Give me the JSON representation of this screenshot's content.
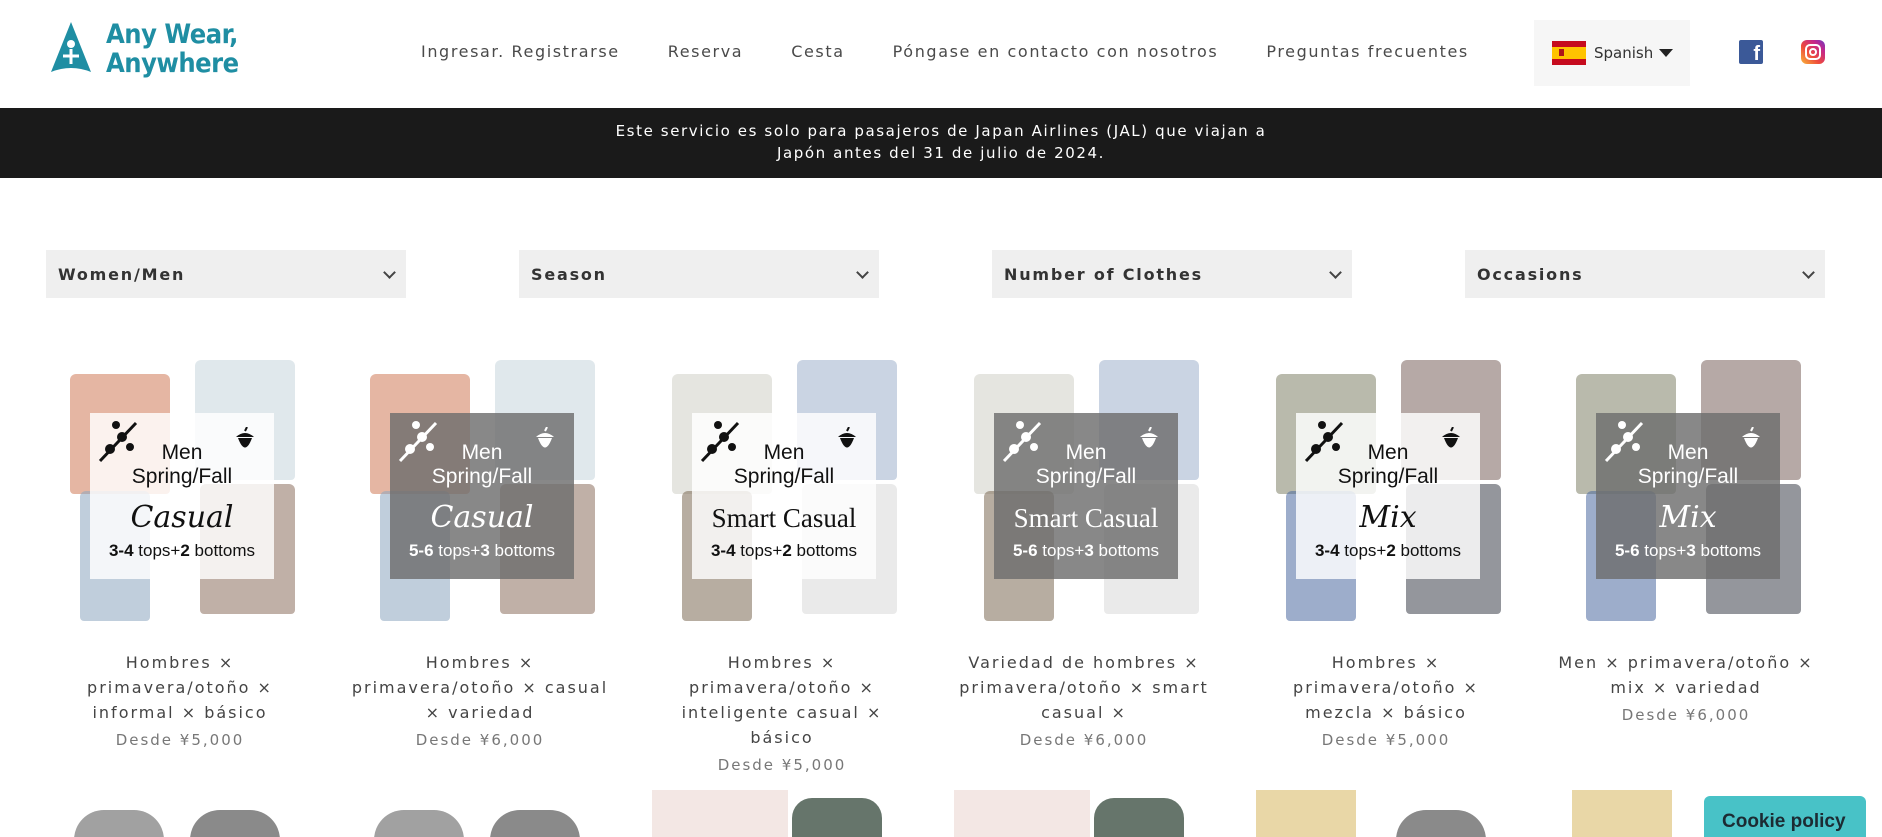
{
  "brand": {
    "name_line1": "Any Wear,",
    "name_line2": "Anywhere",
    "color": "#1f8ea3"
  },
  "nav": {
    "login": "Ingresar. Registrarse",
    "reserve": "Reserva",
    "cart": "Cesta",
    "contact": "Póngase en contacto con nosotros",
    "faq": "Preguntas frecuentes"
  },
  "language": {
    "selected": "Spanish"
  },
  "banner": {
    "line1": "Este servicio es solo para pasajeros de Japan Airlines (JAL) que viajan a",
    "line2": "Japón antes del 31 de julio de 2024."
  },
  "filters": {
    "gender": "Women/Men",
    "season": "Season",
    "clothes": "Number of Clothes",
    "occasions": "Occasions"
  },
  "products": [
    {
      "gender": "Men",
      "season": "Spring/Fall",
      "style": "Casual",
      "tops": "3-4",
      "bottoms": "2",
      "tops_label": " tops+",
      "bottoms_label": " bottoms",
      "title": "Hombres × primavera/otoño × informal × básico",
      "price": "Desde ¥5,000"
    },
    {
      "gender": "Men",
      "season": "Spring/Fall",
      "style": "Casual",
      "tops": "5-6",
      "bottoms": "3",
      "tops_label": " tops+",
      "bottoms_label": " bottoms",
      "title": "Hombres × primavera/otoño × casual × variedad",
      "price": "Desde ¥6,000"
    },
    {
      "gender": "Men",
      "season": "Spring/Fall",
      "style": "Smart Casual",
      "tops": "3-4",
      "bottoms": "2",
      "tops_label": " tops+",
      "bottoms_label": " bottoms",
      "title": "Hombres × primavera/otoño × inteligente casual × básico",
      "price": "Desde ¥5,000"
    },
    {
      "gender": "Men",
      "season": "Spring/Fall",
      "style": "Smart Casual",
      "tops": "5-6",
      "bottoms": "3",
      "tops_label": " tops+",
      "bottoms_label": " bottoms",
      "title": "Variedad de hombres × primavera/otoño × smart casual ×",
      "price": "Desde ¥6,000"
    },
    {
      "gender": "Men",
      "season": "Spring/Fall",
      "style": "Mix",
      "tops": "3-4",
      "bottoms": "2",
      "tops_label": " tops+",
      "bottoms_label": " bottoms",
      "title": "Hombres × primavera/otoño × mezcla × básico",
      "price": "Desde ¥5,000"
    },
    {
      "gender": "Men",
      "season": "Spring/Fall",
      "style": "Mix",
      "tops": "5-6",
      "bottoms": "3",
      "tops_label": " tops+",
      "bottoms_label": " bottoms",
      "title": "Men × primavera/otoño × mix × variedad",
      "price": "Desde ¥6,000"
    }
  ],
  "cookie": {
    "label": "Cookie policy"
  }
}
